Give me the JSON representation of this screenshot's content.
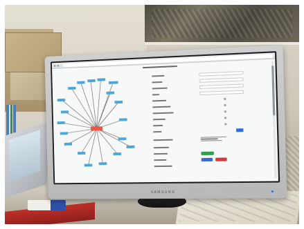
{
  "monitor": {
    "brand": "SAMSUNG"
  },
  "colors": {
    "graph_node": "#4ea6d6",
    "graph_center_node": "#e35d45",
    "button_primary": "#2f6ed8",
    "button_success": "#32a04a",
    "button_danger": "#d8373c"
  },
  "form": {
    "rows": [
      "text",
      "text",
      "select",
      "select",
      "radio",
      "radio",
      "radio",
      "radio",
      "radio",
      "button",
      "text",
      "buttons",
      "buttons",
      "empty"
    ]
  }
}
